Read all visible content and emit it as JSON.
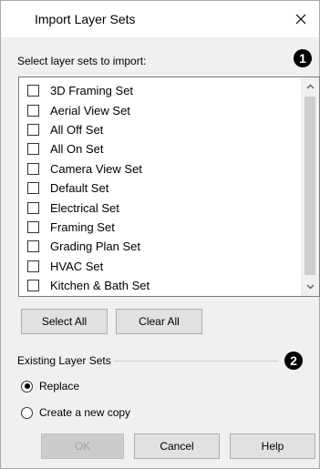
{
  "dialog": {
    "title": "Import Layer Sets",
    "close_glyph": "×"
  },
  "instruction": "Select layer sets to import:",
  "callouts": [
    "1",
    "2"
  ],
  "layer_sets": [
    {
      "label": "3D Framing Set",
      "checked": false
    },
    {
      "label": "Aerial View Set",
      "checked": false
    },
    {
      "label": "All Off Set",
      "checked": false
    },
    {
      "label": "All On Set",
      "checked": false
    },
    {
      "label": "Camera View Set",
      "checked": false
    },
    {
      "label": "Default Set",
      "checked": false
    },
    {
      "label": "Electrical Set",
      "checked": false
    },
    {
      "label": "Framing Set",
      "checked": false
    },
    {
      "label": "Grading Plan Set",
      "checked": false
    },
    {
      "label": "HVAC Set",
      "checked": false
    },
    {
      "label": "Kitchen & Bath Set",
      "checked": false
    }
  ],
  "list_buttons": {
    "select_all": "Select All",
    "clear_all": "Clear All"
  },
  "existing": {
    "group_label": "Existing Layer Sets",
    "options": [
      {
        "label": "Replace",
        "selected": true
      },
      {
        "label": "Create a new copy",
        "selected": false
      }
    ]
  },
  "footer": {
    "ok": "OK",
    "cancel": "Cancel",
    "help": "Help",
    "ok_enabled": false
  },
  "icons": {
    "close": "close-icon",
    "scroll_up": "chevron-up-icon",
    "scroll_down": "chevron-down-icon"
  }
}
